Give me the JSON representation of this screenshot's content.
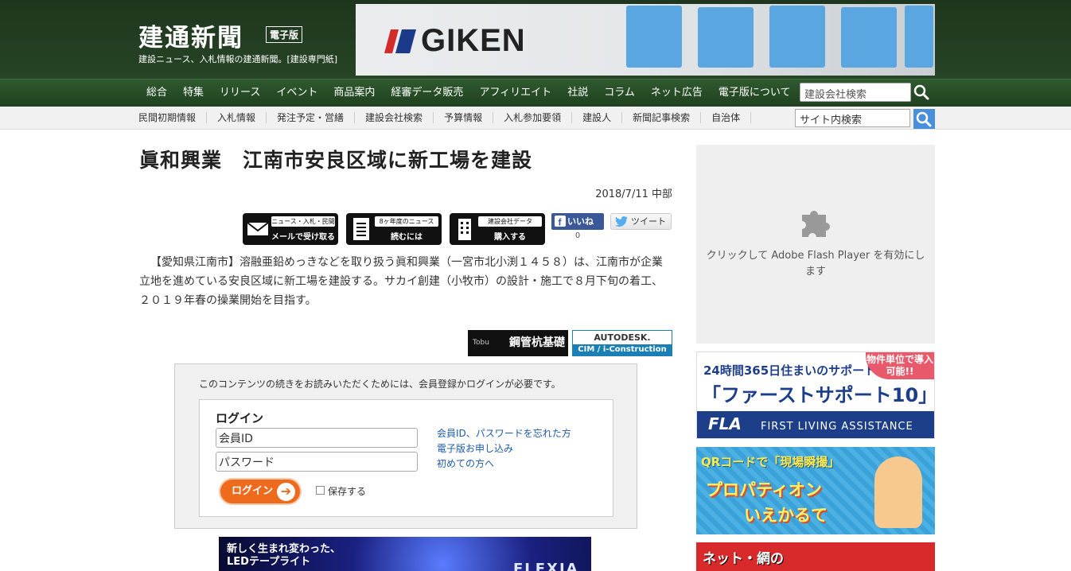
{
  "header": {
    "logo": "建通新聞",
    "logo_badge": "電子版",
    "tagline": "建設ニュース、入札情報の建通新聞。[建設専門紙]",
    "banner": {
      "brand": "GIKEN"
    }
  },
  "main_nav": {
    "items": [
      "総合",
      "特集",
      "リリース",
      "イベント",
      "商品案内",
      "経審データ販売",
      "アフィリエイト",
      "社説",
      "コラム",
      "ネット広告",
      "電子版について"
    ],
    "search_placeholder": "建設会社検索"
  },
  "sub_nav": {
    "items": [
      "民間初期情報",
      "入札情報",
      "発注予定・営繕",
      "建設会社検索",
      "予算情報",
      "入札参加要領",
      "建設人",
      "新聞記事検索",
      "自治体"
    ],
    "search_placeholder": "サイト内検索"
  },
  "article": {
    "headline": "眞和興業　江南市安良区域に新工場を建設",
    "dateline": "2018/7/11 中部",
    "service_buttons": [
      {
        "title": "ニュース・入札・民間",
        "sub": "メールで受け取る",
        "icon": "mail-icon"
      },
      {
        "title": "8ヶ年度のニュース",
        "sub": "読むには",
        "icon": "document-icon"
      },
      {
        "title": "建設会社データ",
        "sub": "購入する",
        "icon": "building-icon"
      }
    ],
    "social": {
      "fb_label": "いいね",
      "fb_count": "0",
      "tweet_label": "ツイート"
    },
    "body": "【愛知県江南市】溶融亜鉛めっきなどを取り扱う眞和興業（一宮市北小渕１４５８）は、江南市が企業立地を進めている安良区域に新工場を建設する。サカイ創建（小牧市）の設計・施工で８月下旬の着工、２０１９年春の操業開始を目指す。",
    "ads": {
      "tube": {
        "small": "Tobu",
        "label": "鋼管杭基礎"
      },
      "autodesk": {
        "top": "AUTODESK.",
        "bottom": "CIM / i-Construction"
      }
    }
  },
  "login": {
    "notice": "このコンテンツの続きをお読みいただくためには、会員登録かログインが必要です。",
    "title": "ログイン",
    "id_placeholder": "会員ID",
    "password_placeholder": "パスワード",
    "button_label": "ログイン",
    "remember_label": "保存する",
    "links": [
      "会員ID、パスワードを忘れた方",
      "電子版お申し込み",
      "初めての方へ"
    ]
  },
  "bottom_ad": {
    "line1": "新しく生まれ変わった、",
    "line2": "LEDテープライト",
    "brand": "FLEXIA"
  },
  "sidebar": {
    "flash_text": "クリックして Adobe Flash Player を有効にします",
    "ad_fla": {
      "line1": "24時間365日住まいのサポート",
      "line2": "「ファーストサポート10」",
      "corner": "物件単位で導入可能!!",
      "brand": "FLA",
      "brand_sub": "FIRST LIVING ASSISTANCE"
    },
    "ad_qr": {
      "line1": "QRコードで「現場瞬撮」",
      "line2": "プロパティオン",
      "line3": "いえかるて"
    },
    "ad_net": {
      "label": "ネット・網の"
    }
  },
  "colors": {
    "header_bg": "#1e361d",
    "nav_bg": "#2f5a2e",
    "accent_orange": "#ee6a1d",
    "link_blue": "#1e5aa8",
    "fb_blue": "#3b5998"
  }
}
